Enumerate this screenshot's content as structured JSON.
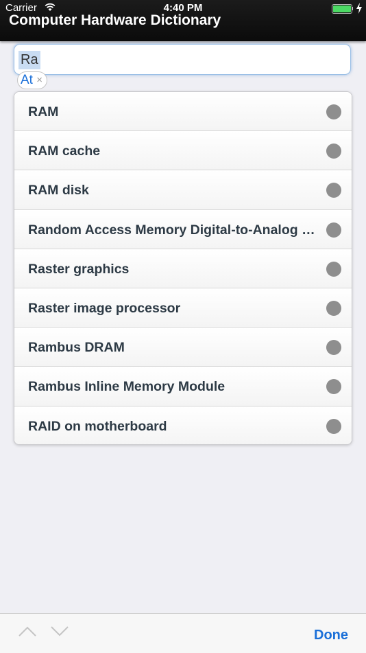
{
  "status_bar": {
    "carrier": "Carrier",
    "time": "4:40 PM",
    "battery_level": 1.0
  },
  "header": {
    "title": "Computer Hardware Dictionary"
  },
  "search": {
    "value": "Ra",
    "suggestion_chip": "At",
    "chip_close": "×"
  },
  "results": [
    {
      "label": "RAM"
    },
    {
      "label": "RAM cache"
    },
    {
      "label": "RAM disk"
    },
    {
      "label": "Random Access Memory Digital-to-Analog Converter"
    },
    {
      "label": "Raster graphics"
    },
    {
      "label": "Raster image processor"
    },
    {
      "label": "Rambus DRAM"
    },
    {
      "label": "Rambus Inline Memory Module"
    },
    {
      "label": "RAID on motherboard"
    }
  ],
  "toolbar": {
    "done_label": "Done",
    "prev_icon": "chevron-up-icon",
    "next_icon": "chevron-down-icon"
  },
  "colors": {
    "accent": "#1a6fd8",
    "header_bg": "#111111",
    "dot": "#8e8e8e",
    "battery": "#4cd964"
  }
}
